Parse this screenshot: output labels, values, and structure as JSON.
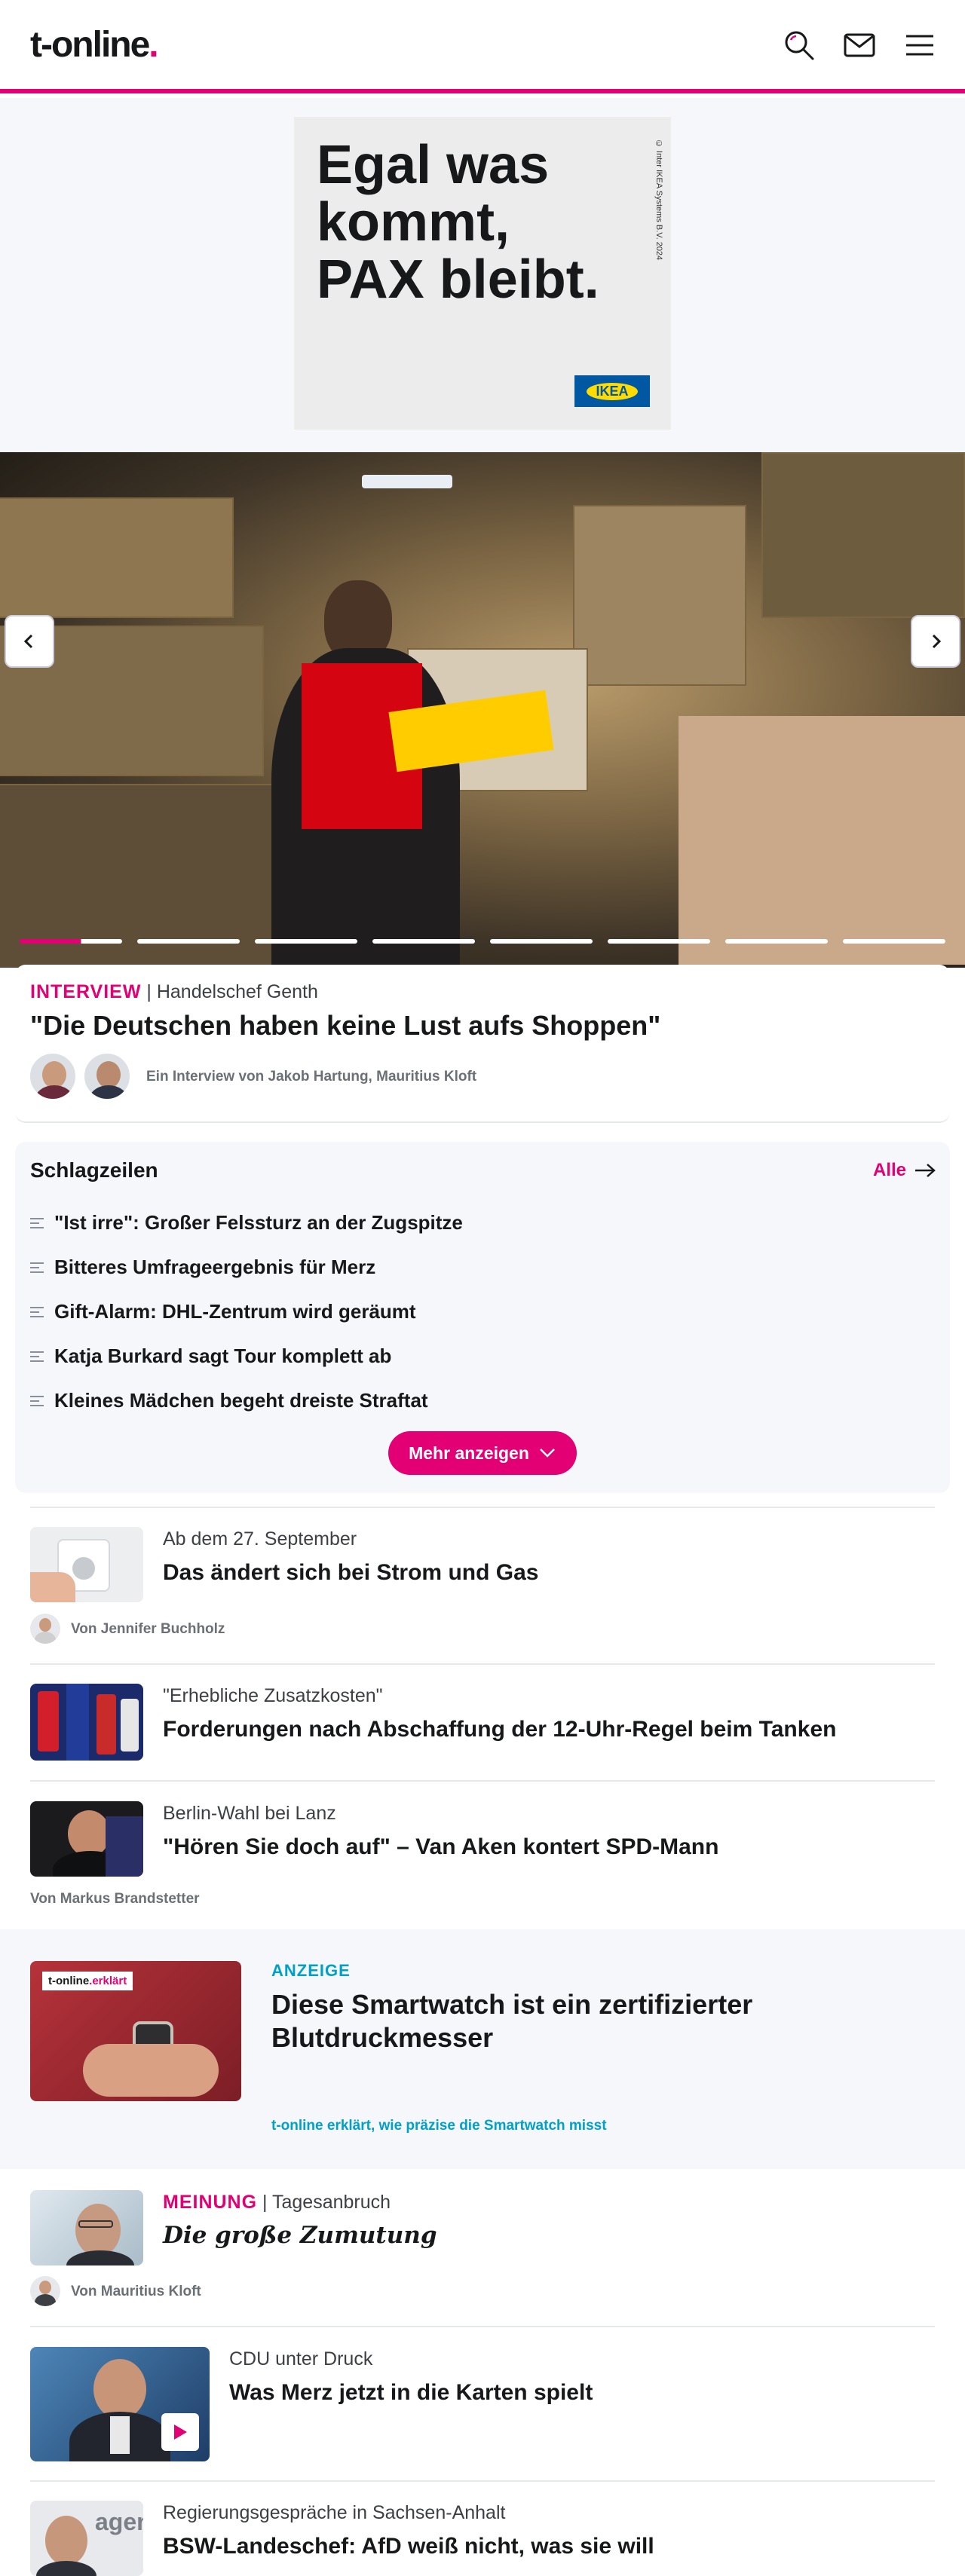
{
  "header": {
    "logo_text": "t-online",
    "logo_dot": ".",
    "accent": "#e20074",
    "icons": [
      "search-icon",
      "mail-icon",
      "menu-icon"
    ]
  },
  "ad_top": {
    "line1": "Egal was",
    "line2": "kommt,",
    "line3": "PAX bleibt.",
    "copyright": "© Inter IKEA Systems B.V. 2024",
    "brand": "IKEA"
  },
  "lead": {
    "kicker_label": "INTERVIEW",
    "kicker_sep": " | ",
    "kicker_topic": "Handelschef Genth",
    "title": "\"Die Deutschen haben keine Lust aufs Shoppen\"",
    "byline": "Ein Interview von Jakob Hartung, Mauritius Kloft"
  },
  "headlines": {
    "title": "Schlagzeilen",
    "all_label": "Alle",
    "items": [
      "\"Ist irre\": Großer Felssturz an der Zugspitze",
      "Bitteres Umfrageergebnis für Merz",
      "Gift-Alarm: DHL-Zentrum wird geräumt",
      "Katja Burkard sagt Tour komplett ab",
      "Kleines Mädchen begeht dreiste Straftat"
    ],
    "more_label": "Mehr anzeigen"
  },
  "teasers": [
    {
      "kicker": "Ab dem 27. September",
      "title": "Das ändert sich bei Strom und Gas",
      "byline": "Von Jennifer Buchholz"
    },
    {
      "kicker": "\"Erhebliche Zusatzkosten\"",
      "title": "Forderungen nach Abschaffung der 12-Uhr-Regel beim Tanken"
    },
    {
      "kicker": "Berlin-Wahl bei Lanz",
      "title": "\"Hören Sie doch auf\" – Van Aken kontert SPD-Mann",
      "byline": "Von Markus Brandstetter"
    }
  ],
  "sponsored": {
    "label": "ANZEIGE",
    "title": "Diese Smartwatch ist ein zertifizierter Blutdruckmesser",
    "subline": "t-online erklärt, wie präzise die Smartwatch misst",
    "badge_brand": "t-online",
    "badge_suffix": ".erklärt"
  },
  "opinion": {
    "kicker_label": "MEINUNG",
    "kicker_sep": " | ",
    "kicker_topic": "Tagesanbruch",
    "title": "Die große Zumutung",
    "byline": "Von Mauritius Kloft"
  },
  "video_teaser": {
    "kicker": "CDU unter Druck",
    "title": "Was Merz jetzt in die Karten spielt"
  },
  "last_teaser": {
    "kicker": "Regierungsgespräche in Sachsen-Anhalt",
    "title": "BSW-Landeschef: AfD weiß nicht, was sie will"
  }
}
